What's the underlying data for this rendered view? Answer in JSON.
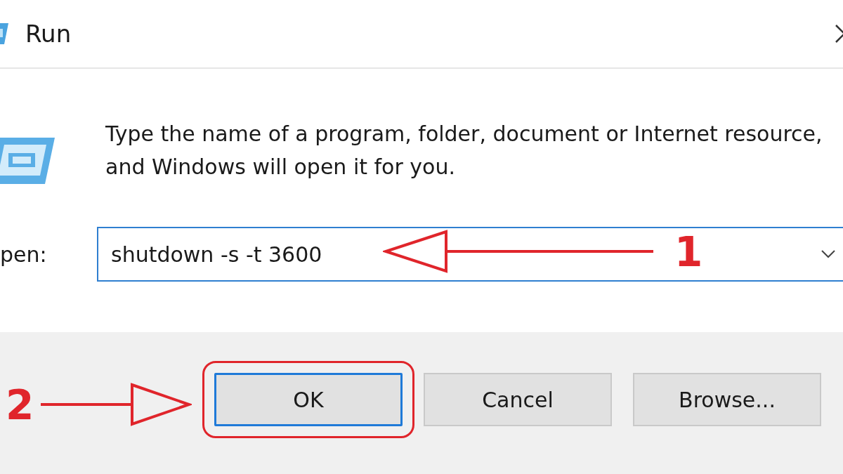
{
  "window": {
    "title": "Run"
  },
  "description": "Type the name of a program, folder, document or Internet resource, and Windows will open it for you.",
  "open_field": {
    "label": "pen:",
    "value": "shutdown -s -t 3600"
  },
  "buttons": [
    {
      "label": "OK",
      "default": true,
      "highlighted": true
    },
    {
      "label": "Cancel",
      "default": false,
      "highlighted": false
    },
    {
      "label": "Browse...",
      "default": false,
      "highlighted": false
    }
  ],
  "annotations": [
    {
      "label": "1",
      "kind": "points-left"
    },
    {
      "label": "2",
      "kind": "points-right"
    }
  ]
}
